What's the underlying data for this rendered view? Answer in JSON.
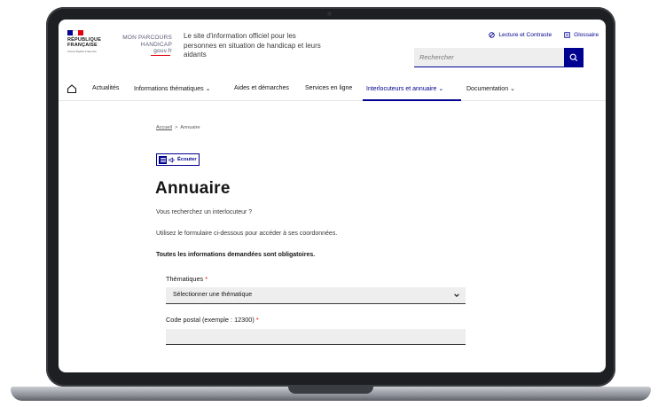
{
  "header": {
    "republique_line1": "RÉPUBLIQUE",
    "republique_line2": "FRANÇAISE",
    "devise": "Liberté Égalité Fraternité",
    "site_logo_line1": "MON PARCOURS",
    "site_logo_line2": "HANDICAP",
    "site_logo_line3": "gouv.fr",
    "tagline": "Le site d'information officiel pour les personnes en situation de handicap et leurs aidants",
    "tool_contrast": "Lecture et Contraste",
    "tool_glossary": "Glossaire",
    "search_placeholder": "Rechercher"
  },
  "nav": {
    "items": [
      {
        "label": "Actualités"
      },
      {
        "label": "Informations thématiques"
      },
      {
        "label": "Aides et démarches"
      },
      {
        "label": "Services en ligne"
      },
      {
        "label": "Interlocuteurs et annuaire"
      },
      {
        "label": "Documentation"
      }
    ]
  },
  "main": {
    "breadcrumb_home": "Accueil",
    "breadcrumb_sep": ">",
    "breadcrumb_current": "Annuaire",
    "listen_label": "Écouter",
    "title": "Annuaire",
    "intro1": "Vous recherchez un interlocuteur ?",
    "intro2": "Utilisez le formulaire ci-dessous pour accéder à ses coordonnées.",
    "required_note": "Toutes les informations demandées sont obligatoires.",
    "field_theme_label": "Thématiques",
    "field_theme_value": "Sélectionner une thématique",
    "field_postal_label": "Code postal (exemple : 12300)",
    "required_mark": "*"
  },
  "colors": {
    "primary": "#000091",
    "marianne_red": "#e1000f",
    "frame": "#1d1f22"
  }
}
